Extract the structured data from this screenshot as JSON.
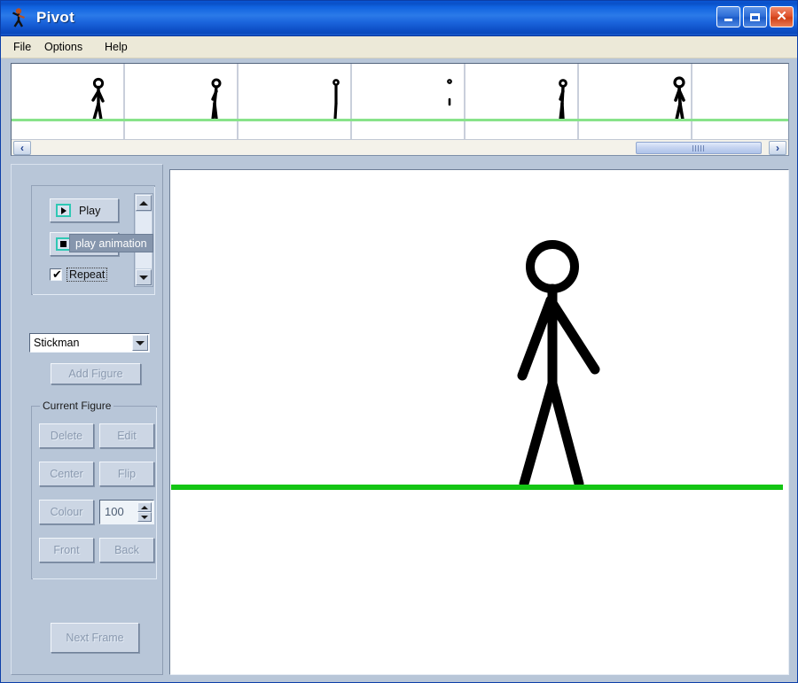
{
  "window": {
    "title": "Pivot",
    "icon": "stickman-app-icon",
    "buttons": {
      "minimize": "minimize-button",
      "maximize": "maximize-button",
      "close": "close-button"
    }
  },
  "menu": {
    "items": [
      {
        "label": "File"
      },
      {
        "label": "Options"
      },
      {
        "label": "Help"
      }
    ]
  },
  "framestrip": {
    "frame_count": 7,
    "frame_width": 128,
    "ground_color": "#88e38a",
    "frames": [
      {
        "index": 1,
        "pose": "walk-a"
      },
      {
        "index": 2,
        "pose": "walk-b"
      },
      {
        "index": 3,
        "pose": "walk-c"
      },
      {
        "index": 4,
        "pose": "walk-d"
      },
      {
        "index": 5,
        "pose": "walk-e"
      },
      {
        "index": 6,
        "pose": "stand"
      },
      {
        "index": 7,
        "pose": "empty"
      }
    ],
    "scroll": {
      "left_arrow": "‹",
      "right_arrow": "›",
      "thumb_position_pct": 80
    }
  },
  "playback": {
    "play_label": "Play",
    "stop_label": "",
    "repeat_label": "Repeat",
    "repeat_checked": true,
    "check_glyph": "✔",
    "icon_accent_color": "#2fc8b4",
    "speed_scroll": {
      "up_arrow": "up-arrow",
      "down_arrow": "down-arrow"
    }
  },
  "tooltip": {
    "text": "play animation",
    "background": "#8696ad",
    "color": "#ffffff"
  },
  "figure_selector": {
    "selected": "Stickman",
    "options": [
      "Stickman"
    ],
    "add_label": "Add Figure",
    "add_enabled": false
  },
  "current_figure": {
    "legend": "Current Figure",
    "buttons": [
      {
        "label": "Delete",
        "enabled": false
      },
      {
        "label": "Edit",
        "enabled": false
      },
      {
        "label": "Center",
        "enabled": false
      },
      {
        "label": "Flip",
        "enabled": false
      },
      {
        "label": "Colour",
        "enabled": false
      },
      {
        "label": "Front",
        "enabled": false
      },
      {
        "label": "Back",
        "enabled": false
      }
    ],
    "scale_value": "100"
  },
  "next_frame": {
    "label": "Next Frame",
    "enabled": false
  },
  "canvas": {
    "background": "#ffffff",
    "ground_color": "#14c514",
    "figure": {
      "name": "stickman",
      "stroke_color": "#000000",
      "pose": "standing"
    }
  }
}
